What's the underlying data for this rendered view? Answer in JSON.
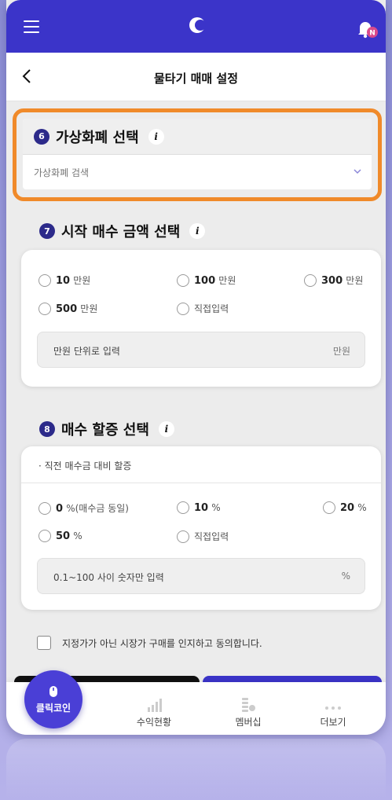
{
  "header": {
    "page_title": "물타기 매매 설정",
    "notification_badge": "N",
    "accent_color": "#3b34c9"
  },
  "section6": {
    "number": "6",
    "title": "가상화폐 선택",
    "info": "i",
    "search_placeholder": "가상화폐 검색"
  },
  "section7": {
    "number": "7",
    "title": "시작 매수 금액 선택",
    "info": "i",
    "options": [
      {
        "value": "10",
        "unit": "만원"
      },
      {
        "value": "100",
        "unit": "만원"
      },
      {
        "value": "300",
        "unit": "만원"
      },
      {
        "value": "500",
        "unit": "만원"
      },
      {
        "label": "직접입력"
      }
    ],
    "input_placeholder": "만원 단위로 입력",
    "input_unit": "만원"
  },
  "section8": {
    "number": "8",
    "title": "매수 할증 선택",
    "info": "i",
    "note": "· 직전 매수금 대비 할증",
    "options": [
      {
        "value": "0",
        "unit": "%",
        "extra": "(매수금 동일)"
      },
      {
        "value": "10",
        "unit": "%"
      },
      {
        "value": "20",
        "unit": "%"
      },
      {
        "value": "50",
        "unit": "%"
      },
      {
        "label": "직접입력"
      }
    ],
    "input_placeholder": "0.1~100 사이 숫자만 입력",
    "input_unit": "%"
  },
  "agreement": "지정가가 아닌 시장가 구매를 인지하고 동의합니다.",
  "tabbar": {
    "fab_label": "클릭코인",
    "tabs": [
      "수익현황",
      "멤버십",
      "더보기"
    ]
  }
}
